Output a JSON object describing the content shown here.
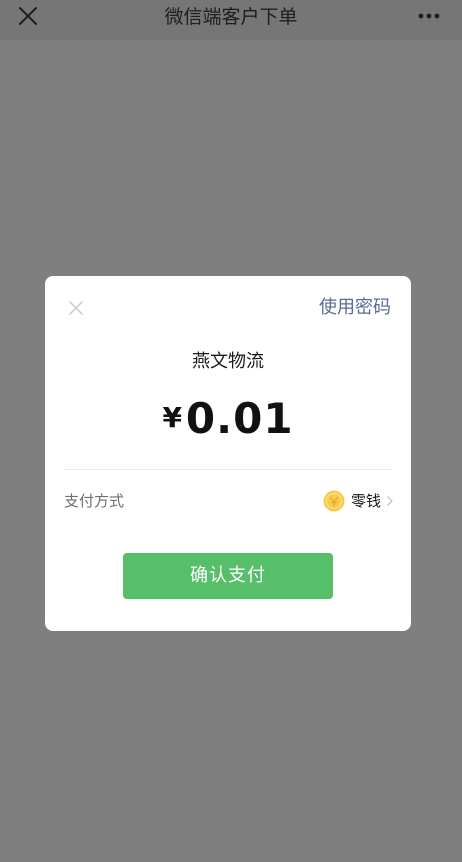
{
  "nav": {
    "title": "微信端客户下单"
  },
  "dialog": {
    "use_password_label": "使用密码",
    "merchant_name": "燕文物流",
    "currency_symbol": "¥",
    "amount": "0.01",
    "pay_method_label": "支付方式",
    "pay_method_value": "零钱",
    "confirm_label": "确认支付"
  },
  "colors": {
    "overlay": "#7f7f7f",
    "link": "#576b95",
    "confirm": "#57be6a",
    "coin": "#f6cc4a"
  },
  "icons": {
    "nav_close": "close-icon",
    "nav_more": "more-icon",
    "dialog_close": "close-icon",
    "pay_method": "coin-icon",
    "pay_method_arrow": "chevron-right-icon"
  }
}
